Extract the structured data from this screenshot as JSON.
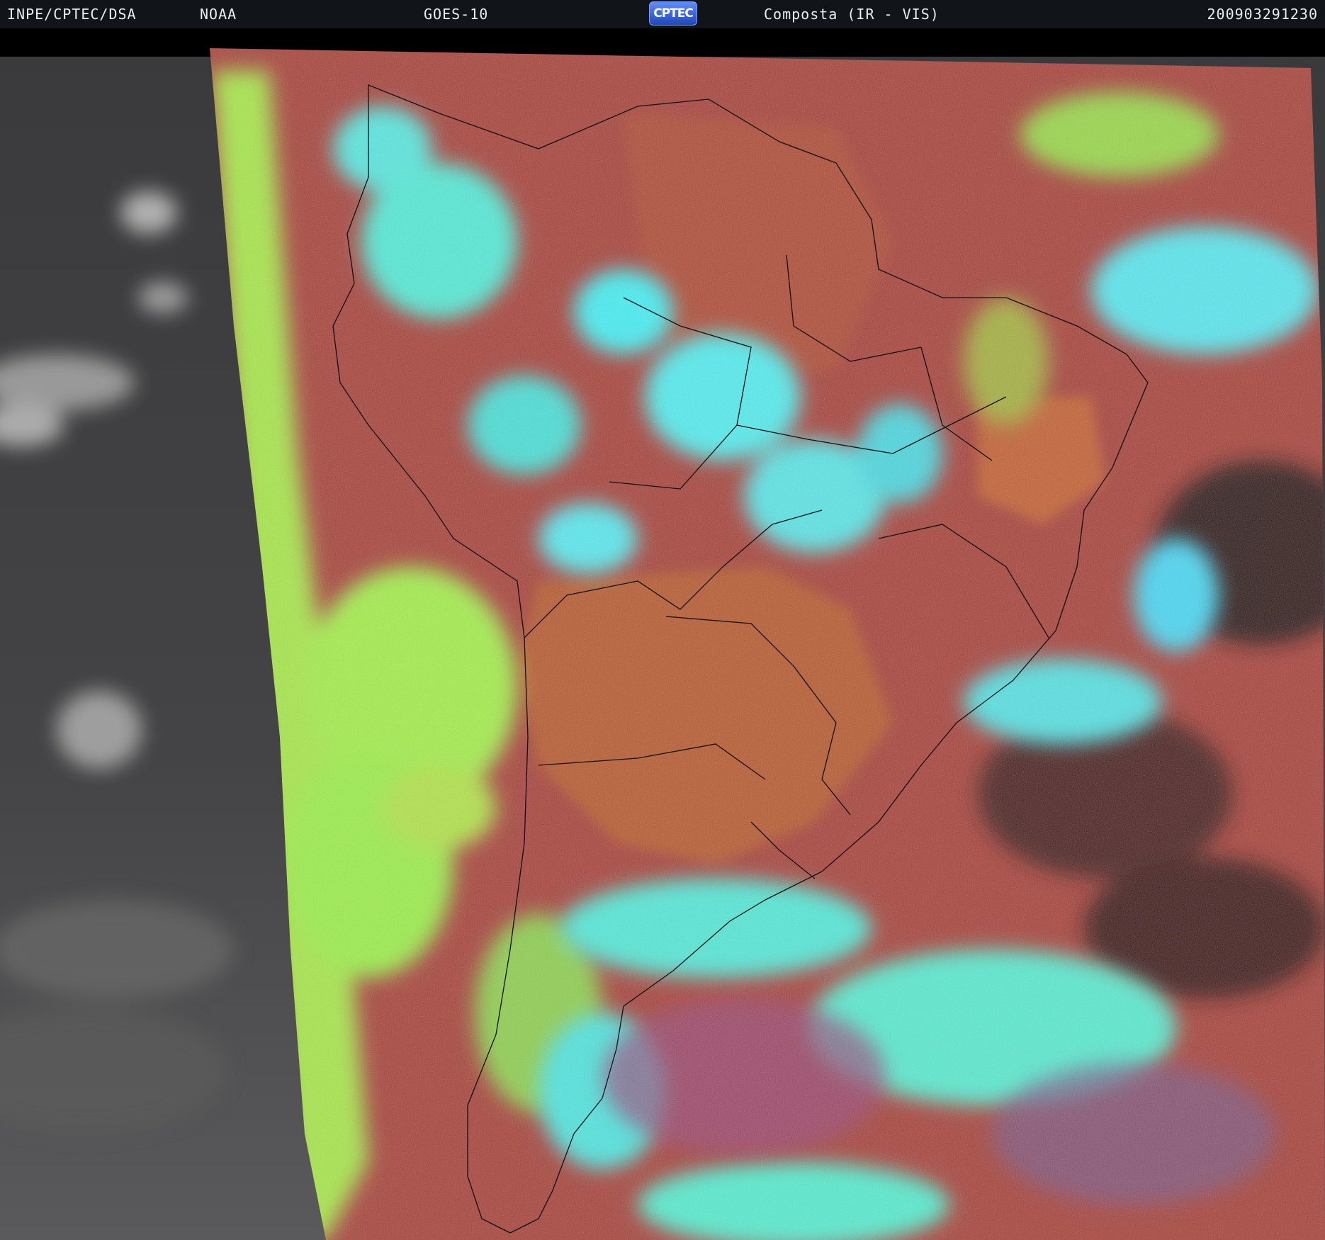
{
  "header": {
    "source": "INPE/CPTEC/DSA",
    "agency": "NOAA",
    "satellite": "GOES-10",
    "logo_text": "CPTEC",
    "product": "Composta (IR - VIS)",
    "timestamp": "200903291230"
  },
  "colors": {
    "header_bg": "#111418",
    "ocean_clear": "#a8423a",
    "land_clear": "#b55530",
    "low_cloud": "#9cf04a",
    "high_cloud": "#52f0e8",
    "west_vis": "#4a4a4a",
    "dark_void": "#1a1414"
  }
}
